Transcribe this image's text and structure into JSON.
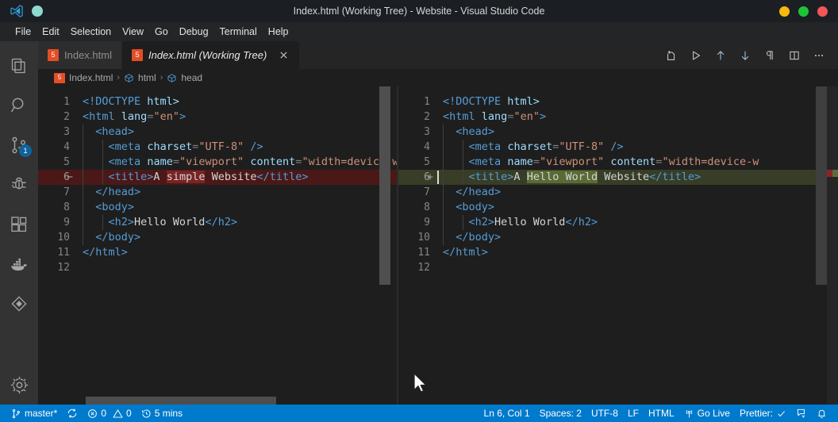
{
  "window": {
    "title": "Index.html (Working Tree) - Website - Visual Studio Code",
    "controls": [
      {
        "name": "minimize",
        "color": "#f5b90f"
      },
      {
        "name": "maximize",
        "color": "#1ec337"
      },
      {
        "name": "close",
        "color": "#f3555a"
      }
    ]
  },
  "menubar": {
    "items": [
      "File",
      "Edit",
      "Selection",
      "View",
      "Go",
      "Debug",
      "Terminal",
      "Help"
    ]
  },
  "activitybar": {
    "items": [
      {
        "icon": "files-icon",
        "label": "Explorer",
        "badge": ""
      },
      {
        "icon": "search-icon",
        "label": "Search",
        "badge": ""
      },
      {
        "icon": "source-control-icon",
        "label": "Source Control",
        "badge": "1"
      },
      {
        "icon": "debug-icon",
        "label": "Run and Debug",
        "badge": ""
      },
      {
        "icon": "extensions-icon",
        "label": "Extensions",
        "badge": ""
      },
      {
        "icon": "docker-icon",
        "label": "Docker",
        "badge": ""
      },
      {
        "icon": "diamond-icon",
        "label": "Remote Explorer",
        "badge": ""
      }
    ],
    "bottom": {
      "icon": "gear-icon",
      "label": "Manage"
    }
  },
  "tabs": [
    {
      "title": "Index.html",
      "icon": "html5-icon",
      "glyph": "5",
      "active": false,
      "closable": false
    },
    {
      "title": "Index.html (Working Tree)",
      "icon": "html5-icon",
      "glyph": "5",
      "active": true,
      "closable": true
    }
  ],
  "editor_actions": [
    {
      "name": "open-changes-icon",
      "label": "Open Changes"
    },
    {
      "name": "run-icon",
      "label": "Run"
    },
    {
      "name": "previous-change-icon",
      "label": "Previous Change"
    },
    {
      "name": "next-change-icon",
      "label": "Next Change"
    },
    {
      "name": "whitespace-icon",
      "label": "Toggle Whitespace"
    },
    {
      "name": "split-editor-icon",
      "label": "Split Editor"
    },
    {
      "name": "more-actions-icon",
      "label": "More Actions..."
    }
  ],
  "breadcrumb": {
    "items": [
      {
        "label": "Index.html",
        "icon": "html5-icon"
      },
      {
        "label": "html",
        "icon": "symbol-cube-icon"
      },
      {
        "label": "head",
        "icon": "symbol-cube-icon"
      }
    ],
    "separator": "›"
  },
  "diff": {
    "left": {
      "name": "original",
      "lines": [
        {
          "num": "1",
          "sign": "",
          "state": "none",
          "indent": 0,
          "tokens": [
            {
              "t": "<!DOCTYPE",
              "c": "t-dt"
            },
            {
              "t": " html>",
              "c": "t-name"
            }
          ]
        },
        {
          "num": "2",
          "sign": "",
          "state": "none",
          "indent": 0,
          "tokens": [
            {
              "t": "<",
              "c": "t-tag"
            },
            {
              "t": "html",
              "c": "t-tag"
            },
            {
              "t": " ",
              "c": "t-txt"
            },
            {
              "t": "lang",
              "c": "t-attr"
            },
            {
              "t": "=",
              "c": "t-punc"
            },
            {
              "t": "\"en\"",
              "c": "t-str"
            },
            {
              "t": ">",
              "c": "t-tag"
            }
          ]
        },
        {
          "num": "3",
          "sign": "",
          "state": "none",
          "indent": 1,
          "tokens": [
            {
              "t": "  ",
              "c": "t-txt"
            },
            {
              "t": "<head>",
              "c": "t-tag"
            }
          ]
        },
        {
          "num": "4",
          "sign": "",
          "state": "none",
          "indent": 2,
          "tokens": [
            {
              "t": "    ",
              "c": "t-txt"
            },
            {
              "t": "<",
              "c": "t-tag"
            },
            {
              "t": "meta",
              "c": "t-tag"
            },
            {
              "t": " ",
              "c": "t-txt"
            },
            {
              "t": "charset",
              "c": "t-attr"
            },
            {
              "t": "=",
              "c": "t-punc"
            },
            {
              "t": "\"UTF-8\"",
              "c": "t-str"
            },
            {
              "t": " ",
              "c": "t-txt"
            },
            {
              "t": "/>",
              "c": "t-tag"
            }
          ]
        },
        {
          "num": "5",
          "sign": "",
          "state": "none",
          "indent": 2,
          "tokens": [
            {
              "t": "    ",
              "c": "t-txt"
            },
            {
              "t": "<",
              "c": "t-tag"
            },
            {
              "t": "meta",
              "c": "t-tag"
            },
            {
              "t": " ",
              "c": "t-txt"
            },
            {
              "t": "name",
              "c": "t-attr"
            },
            {
              "t": "=",
              "c": "t-punc"
            },
            {
              "t": "\"viewport\"",
              "c": "t-str"
            },
            {
              "t": " ",
              "c": "t-txt"
            },
            {
              "t": "content",
              "c": "t-attr"
            },
            {
              "t": "=",
              "c": "t-punc"
            },
            {
              "t": "\"width=device-w",
              "c": "t-str"
            }
          ]
        },
        {
          "num": "6",
          "sign": "−",
          "state": "del",
          "indent": 2,
          "tokens": [
            {
              "t": "    ",
              "c": "t-txt"
            },
            {
              "t": "<title>",
              "c": "t-tag"
            },
            {
              "t": "A ",
              "c": "t-txt"
            },
            {
              "t": "simple",
              "c": "t-txt wdel"
            },
            {
              "t": " Website",
              "c": "t-txt"
            },
            {
              "t": "</title>",
              "c": "t-tag"
            }
          ]
        },
        {
          "num": "7",
          "sign": "",
          "state": "none",
          "indent": 1,
          "tokens": [
            {
              "t": "  ",
              "c": "t-txt"
            },
            {
              "t": "</head>",
              "c": "t-tag"
            }
          ]
        },
        {
          "num": "8",
          "sign": "",
          "state": "none",
          "indent": 1,
          "tokens": [
            {
              "t": "  ",
              "c": "t-txt"
            },
            {
              "t": "<body>",
              "c": "t-tag"
            }
          ]
        },
        {
          "num": "9",
          "sign": "",
          "state": "none",
          "indent": 2,
          "tokens": [
            {
              "t": "    ",
              "c": "t-txt"
            },
            {
              "t": "<h2>",
              "c": "t-tag"
            },
            {
              "t": "Hello World",
              "c": "t-txt"
            },
            {
              "t": "</h2>",
              "c": "t-tag"
            }
          ]
        },
        {
          "num": "10",
          "sign": "",
          "state": "none",
          "indent": 1,
          "tokens": [
            {
              "t": "  ",
              "c": "t-txt"
            },
            {
              "t": "</body>",
              "c": "t-tag"
            }
          ]
        },
        {
          "num": "11",
          "sign": "",
          "state": "none",
          "indent": 0,
          "tokens": [
            {
              "t": "</html>",
              "c": "t-tag"
            }
          ]
        },
        {
          "num": "12",
          "sign": "",
          "state": "none",
          "indent": 0,
          "tokens": []
        }
      ]
    },
    "right": {
      "name": "modified",
      "cursor_line": 6,
      "lines": [
        {
          "num": "1",
          "sign": "",
          "state": "none",
          "indent": 0,
          "tokens": [
            {
              "t": "<!DOCTYPE",
              "c": "t-dt"
            },
            {
              "t": " html>",
              "c": "t-name"
            }
          ]
        },
        {
          "num": "2",
          "sign": "",
          "state": "none",
          "indent": 0,
          "tokens": [
            {
              "t": "<",
              "c": "t-tag"
            },
            {
              "t": "html",
              "c": "t-tag"
            },
            {
              "t": " ",
              "c": "t-txt"
            },
            {
              "t": "lang",
              "c": "t-attr"
            },
            {
              "t": "=",
              "c": "t-punc"
            },
            {
              "t": "\"en\"",
              "c": "t-str"
            },
            {
              "t": ">",
              "c": "t-tag"
            }
          ]
        },
        {
          "num": "3",
          "sign": "",
          "state": "none",
          "indent": 1,
          "tokens": [
            {
              "t": "  ",
              "c": "t-txt"
            },
            {
              "t": "<head>",
              "c": "t-tag"
            }
          ]
        },
        {
          "num": "4",
          "sign": "",
          "state": "none",
          "indent": 2,
          "tokens": [
            {
              "t": "    ",
              "c": "t-txt"
            },
            {
              "t": "<",
              "c": "t-tag"
            },
            {
              "t": "meta",
              "c": "t-tag"
            },
            {
              "t": " ",
              "c": "t-txt"
            },
            {
              "t": "charset",
              "c": "t-attr"
            },
            {
              "t": "=",
              "c": "t-punc"
            },
            {
              "t": "\"UTF-8\"",
              "c": "t-str"
            },
            {
              "t": " ",
              "c": "t-txt"
            },
            {
              "t": "/>",
              "c": "t-tag"
            }
          ]
        },
        {
          "num": "5",
          "sign": "",
          "state": "none",
          "indent": 2,
          "tokens": [
            {
              "t": "    ",
              "c": "t-txt"
            },
            {
              "t": "<",
              "c": "t-tag"
            },
            {
              "t": "meta",
              "c": "t-tag"
            },
            {
              "t": " ",
              "c": "t-txt"
            },
            {
              "t": "name",
              "c": "t-attr"
            },
            {
              "t": "=",
              "c": "t-punc"
            },
            {
              "t": "\"viewport\"",
              "c": "t-str"
            },
            {
              "t": " ",
              "c": "t-txt"
            },
            {
              "t": "content",
              "c": "t-attr"
            },
            {
              "t": "=",
              "c": "t-punc"
            },
            {
              "t": "\"width=device-w",
              "c": "t-str"
            }
          ]
        },
        {
          "num": "6",
          "sign": "+",
          "state": "ins",
          "indent": 2,
          "tokens": [
            {
              "t": "    ",
              "c": "t-txt"
            },
            {
              "t": "<title>",
              "c": "t-tag"
            },
            {
              "t": "A ",
              "c": "t-txt"
            },
            {
              "t": "Hello World",
              "c": "t-txt wins"
            },
            {
              "t": " Website",
              "c": "t-txt"
            },
            {
              "t": "</title>",
              "c": "t-tag"
            }
          ]
        },
        {
          "num": "7",
          "sign": "",
          "state": "none",
          "indent": 1,
          "tokens": [
            {
              "t": "  ",
              "c": "t-txt"
            },
            {
              "t": "</head>",
              "c": "t-tag"
            }
          ]
        },
        {
          "num": "8",
          "sign": "",
          "state": "none",
          "indent": 1,
          "tokens": [
            {
              "t": "  ",
              "c": "t-txt"
            },
            {
              "t": "<body>",
              "c": "t-tag"
            }
          ]
        },
        {
          "num": "9",
          "sign": "",
          "state": "none",
          "indent": 2,
          "tokens": [
            {
              "t": "    ",
              "c": "t-txt"
            },
            {
              "t": "<h2>",
              "c": "t-tag"
            },
            {
              "t": "Hello World",
              "c": "t-txt"
            },
            {
              "t": "</h2>",
              "c": "t-tag"
            }
          ]
        },
        {
          "num": "10",
          "sign": "",
          "state": "none",
          "indent": 1,
          "tokens": [
            {
              "t": "  ",
              "c": "t-txt"
            },
            {
              "t": "</body>",
              "c": "t-tag"
            }
          ]
        },
        {
          "num": "11",
          "sign": "",
          "state": "none",
          "indent": 0,
          "tokens": [
            {
              "t": "</html>",
              "c": "t-tag"
            }
          ]
        },
        {
          "num": "12",
          "sign": "",
          "state": "none",
          "indent": 0,
          "tokens": []
        }
      ]
    },
    "colors": {
      "deleted_line_bg": "#4b1818",
      "deleted_word_bg": "#792424",
      "inserted_line_bg": "#373d26",
      "inserted_word_bg": "#5a6a35",
      "ruler_deleted": "#8b2424",
      "ruler_inserted": "#5e6b3c"
    }
  },
  "statusbar": {
    "left": [
      {
        "name": "branch",
        "icon": "source-control-icon",
        "text": "master*"
      },
      {
        "name": "sync",
        "icon": "sync-icon",
        "text": ""
      },
      {
        "name": "problems",
        "icon": "error-warning-icon",
        "text": "0  0",
        "errors": "0",
        "warnings": "0"
      },
      {
        "name": "timer",
        "icon": "history-icon",
        "text": "5 mins"
      }
    ],
    "right": [
      {
        "name": "cursor-position",
        "icon": "",
        "text": "Ln 6, Col 1"
      },
      {
        "name": "indentation",
        "icon": "",
        "text": "Spaces: 2"
      },
      {
        "name": "encoding",
        "icon": "",
        "text": "UTF-8"
      },
      {
        "name": "eol",
        "icon": "",
        "text": "LF"
      },
      {
        "name": "language-mode",
        "icon": "",
        "text": "HTML"
      },
      {
        "name": "go-live",
        "icon": "broadcast-icon",
        "text": "Go Live"
      },
      {
        "name": "prettier",
        "icon": "check-icon",
        "text": "Prettier:"
      },
      {
        "name": "feedback",
        "icon": "feedback-icon",
        "text": ""
      },
      {
        "name": "notifications",
        "icon": "bell-icon",
        "text": ""
      }
    ],
    "background": "#007acc"
  }
}
